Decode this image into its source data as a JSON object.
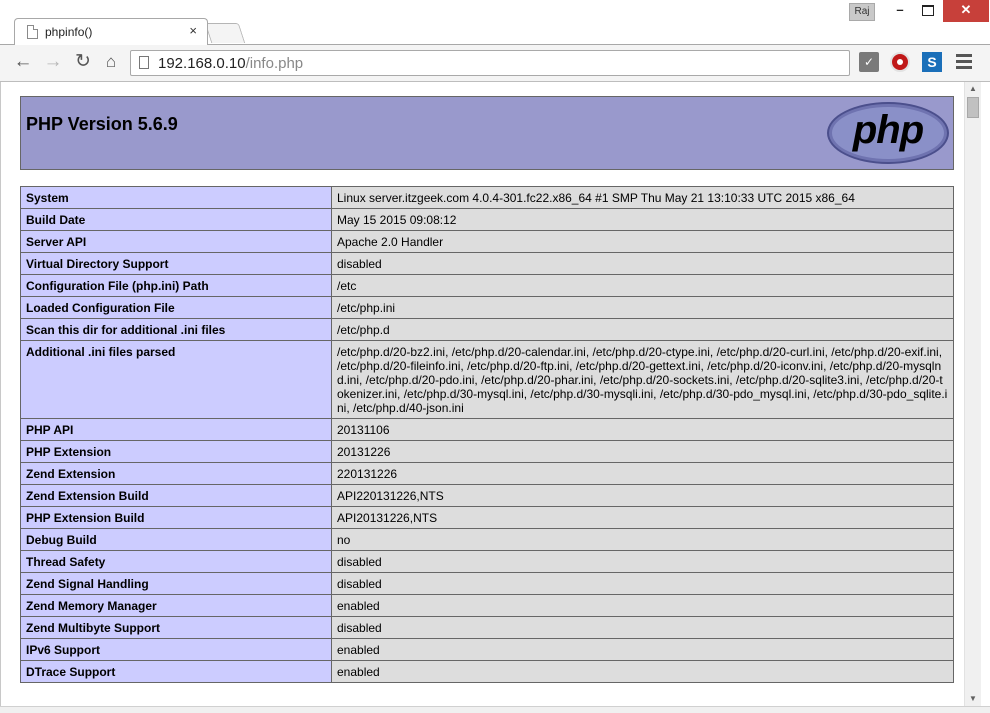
{
  "window": {
    "tab_title": "phpinfo()",
    "tab_close": "×",
    "profile": "Raj",
    "minimize": "–",
    "close": "✕"
  },
  "toolbar": {
    "back": "←",
    "forward": "→",
    "reload": "↻",
    "home": "⌂",
    "url_host": "192.168.0.10",
    "url_path": "/info.php",
    "ext_1": "✓",
    "ext_3": "S"
  },
  "page": {
    "title": "PHP Version 5.6.9",
    "logo_text": "php"
  },
  "rows": [
    {
      "key": "System",
      "value": "Linux server.itzgeek.com 4.0.4-301.fc22.x86_64 #1 SMP Thu May 21 13:10:33 UTC 2015 x86_64"
    },
    {
      "key": "Build Date",
      "value": "May 15 2015 09:08:12"
    },
    {
      "key": "Server API",
      "value": "Apache 2.0 Handler"
    },
    {
      "key": "Virtual Directory Support",
      "value": "disabled"
    },
    {
      "key": "Configuration File (php.ini) Path",
      "value": "/etc"
    },
    {
      "key": "Loaded Configuration File",
      "value": "/etc/php.ini"
    },
    {
      "key": "Scan this dir for additional .ini files",
      "value": "/etc/php.d"
    },
    {
      "key": "Additional .ini files parsed",
      "value": "/etc/php.d/20-bz2.ini, /etc/php.d/20-calendar.ini, /etc/php.d/20-ctype.ini, /etc/php.d/20-curl.ini, /etc/php.d/20-exif.ini, /etc/php.d/20-fileinfo.ini, /etc/php.d/20-ftp.ini, /etc/php.d/20-gettext.ini, /etc/php.d/20-iconv.ini, /etc/php.d/20-mysqlnd.ini, /etc/php.d/20-pdo.ini, /etc/php.d/20-phar.ini, /etc/php.d/20-sockets.ini, /etc/php.d/20-sqlite3.ini, /etc/php.d/20-tokenizer.ini, /etc/php.d/30-mysql.ini, /etc/php.d/30-mysqli.ini, /etc/php.d/30-pdo_mysql.ini, /etc/php.d/30-pdo_sqlite.ini, /etc/php.d/40-json.ini"
    },
    {
      "key": "PHP API",
      "value": "20131106"
    },
    {
      "key": "PHP Extension",
      "value": "20131226"
    },
    {
      "key": "Zend Extension",
      "value": "220131226"
    },
    {
      "key": "Zend Extension Build",
      "value": "API220131226,NTS"
    },
    {
      "key": "PHP Extension Build",
      "value": "API20131226,NTS"
    },
    {
      "key": "Debug Build",
      "value": "no"
    },
    {
      "key": "Thread Safety",
      "value": "disabled"
    },
    {
      "key": "Zend Signal Handling",
      "value": "disabled"
    },
    {
      "key": "Zend Memory Manager",
      "value": "enabled"
    },
    {
      "key": "Zend Multibyte Support",
      "value": "disabled"
    },
    {
      "key": "IPv6 Support",
      "value": "enabled"
    },
    {
      "key": "DTrace Support",
      "value": "enabled"
    }
  ]
}
